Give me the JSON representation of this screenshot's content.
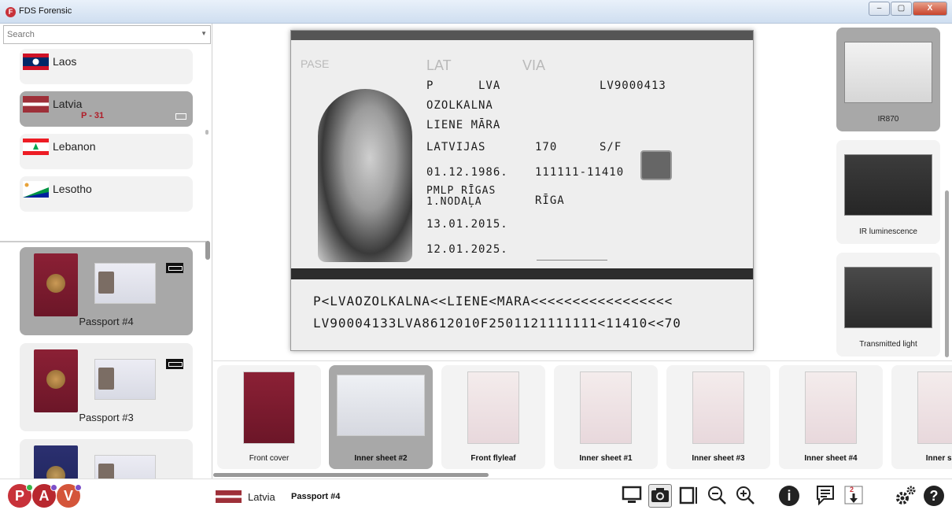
{
  "window": {
    "title": "FDS Forensic",
    "controls": [
      "–",
      "▢",
      "X"
    ]
  },
  "search": {
    "placeholder": "Search"
  },
  "countries": [
    {
      "name": "Laos",
      "count": "",
      "flag_colors": [
        "#ce1126",
        "#002868",
        "#ffffff"
      ]
    },
    {
      "name": "Latvia",
      "count": "P - 31",
      "flag_colors": [
        "#9e3039",
        "#ffffff",
        "#9e3039"
      ]
    },
    {
      "name": "Lebanon",
      "count": "",
      "flag_colors": [
        "#ed1c24",
        "#ffffff",
        "#00a651"
      ]
    },
    {
      "name": "Lesotho",
      "count": "",
      "flag_colors": [
        "#00209f",
        "#ffffff",
        "#009543"
      ]
    }
  ],
  "documents": [
    {
      "name": "Passport #4",
      "cover_color": "red"
    },
    {
      "name": "Passport #3",
      "cover_color": "red"
    },
    {
      "name": "",
      "cover_color": "blue"
    }
  ],
  "passport": {
    "labels": {
      "pase": "PASE",
      "lat": "LAT",
      "via": "VIA"
    },
    "fields": {
      "type": "P",
      "code": "LVA",
      "number": "LV9000413",
      "surname": "OZOLKALNA",
      "given_names": "LIENE MĀRA",
      "nationality": "LATVIJAS",
      "height": "170",
      "sex": "S/F",
      "dob": "01.12.1986.",
      "personal_code": "111111-11410",
      "authority_1": "PMLP RĪGAS",
      "authority_2": "1.NODAĻA",
      "place": "RĪGA",
      "issue_date": "13.01.2015.",
      "expiry_date": "12.01.2025."
    },
    "mrz_line1": "P<LVAOZOLKALNA<<LIENE<MARA<<<<<<<<<<<<<<<<<",
    "mrz_line2": "LV90004133LVA8612010F2501121111111<11410<<70"
  },
  "lights": [
    {
      "name": "IR870",
      "selected": true
    },
    {
      "name": "IR luminescence",
      "selected": false
    },
    {
      "name": "Transmitted light",
      "selected": false
    }
  ],
  "pages": [
    {
      "name": "Front cover",
      "bold": false
    },
    {
      "name": "Inner sheet #2",
      "bold": true
    },
    {
      "name": "Front flyleaf",
      "bold": true
    },
    {
      "name": "Inner sheet #1",
      "bold": true
    },
    {
      "name": "Inner sheet #3",
      "bold": true
    },
    {
      "name": "Inner sheet #4",
      "bold": true
    },
    {
      "name": "Inner she",
      "bold": true
    }
  ],
  "modes": [
    {
      "letter": "P"
    },
    {
      "letter": "A"
    },
    {
      "letter": "V"
    }
  ],
  "selection": {
    "country": "Latvia",
    "document": "Passport #4"
  },
  "toolbar": {
    "icons": [
      "monitor-icon",
      "camera-icon",
      "crop-icon",
      "zoom-out-icon",
      "zoom-in-icon",
      "info-icon",
      "notes-icon",
      "download-icon",
      "settings-icon",
      "help-icon"
    ],
    "download_badge": "2",
    "info_symbol": "i",
    "help_symbol": "?"
  }
}
